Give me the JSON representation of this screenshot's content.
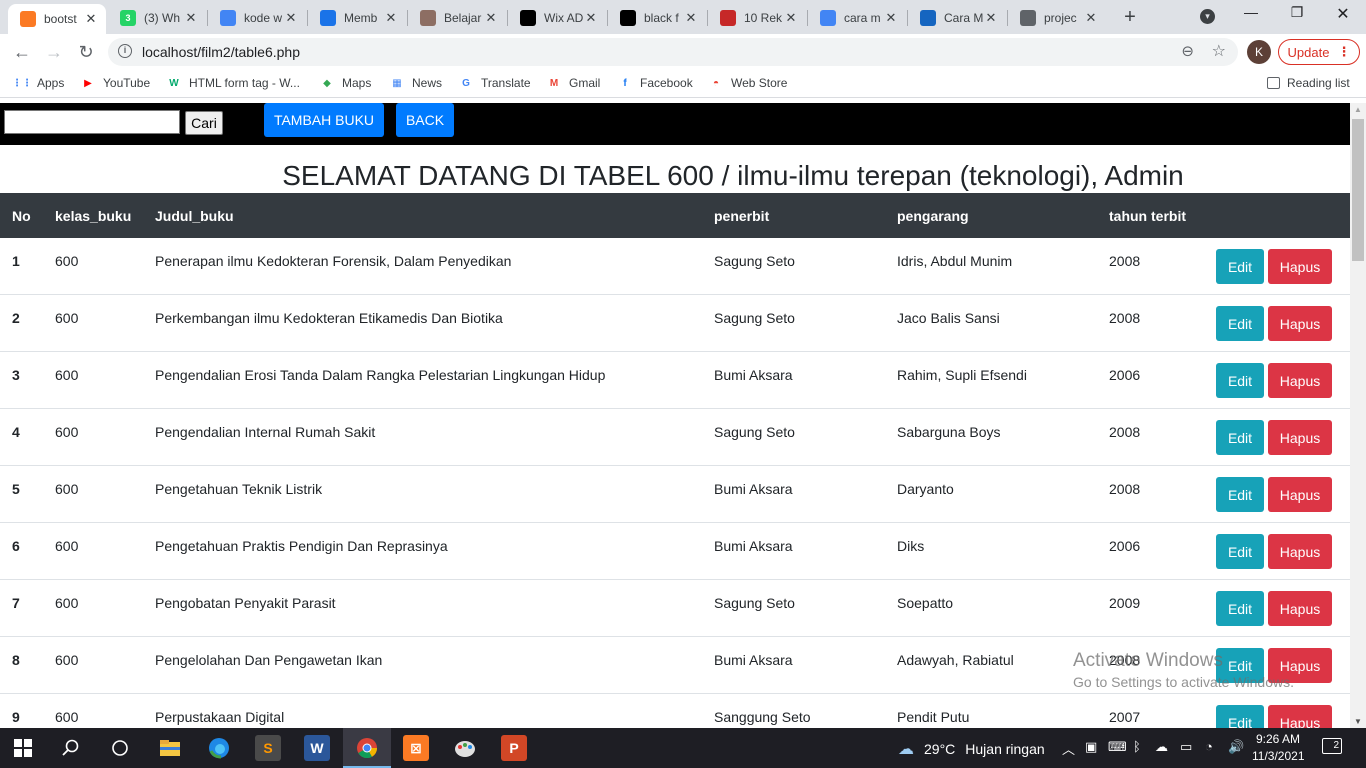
{
  "browser": {
    "tabs": [
      {
        "title": "bootst",
        "icon": "xampp-icon",
        "color": "#fb7a24",
        "active": true
      },
      {
        "title": "(3) Wh",
        "icon": "whatsapp-icon",
        "color": "#25d366",
        "badge": "3"
      },
      {
        "title": "kode w",
        "icon": "google-icon",
        "color": "#4285f4"
      },
      {
        "title": "Memb",
        "icon": "diamond-icon",
        "color": "#1a73e8"
      },
      {
        "title": "Belajar",
        "icon": "avatar-icon",
        "color": "#8d6e63"
      },
      {
        "title": "Wix AD",
        "icon": "wix-icon",
        "color": "#000000"
      },
      {
        "title": "black f",
        "icon": "unsplash-icon",
        "color": "#000000"
      },
      {
        "title": "10 Rek",
        "icon": "r-icon",
        "color": "#c62828"
      },
      {
        "title": "cara m",
        "icon": "google-icon",
        "color": "#4285f4"
      },
      {
        "title": "Cara M",
        "icon": "s-logo-icon",
        "color": "#1565c0"
      },
      {
        "title": "projec",
        "icon": "globe-icon",
        "color": "#5f6368"
      }
    ],
    "url": "localhost/film2/table6.php",
    "profile_initial": "K",
    "update_label": "Update",
    "bookmarks": [
      {
        "label": "Apps",
        "icon": "apps-grid-icon"
      },
      {
        "label": "YouTube",
        "icon": "youtube-icon"
      },
      {
        "label": "HTML form tag - W...",
        "icon": "w3schools-icon"
      },
      {
        "label": "Maps",
        "icon": "maps-icon"
      },
      {
        "label": "News",
        "icon": "news-icon"
      },
      {
        "label": "Translate",
        "icon": "translate-icon"
      },
      {
        "label": "Gmail",
        "icon": "gmail-icon"
      },
      {
        "label": "Facebook",
        "icon": "facebook-icon"
      },
      {
        "label": "Web Store",
        "icon": "webstore-icon"
      }
    ],
    "reading_list": "Reading list"
  },
  "page": {
    "search_button": "Cari",
    "search_value": "",
    "add_button": "TAMBAH BUKU",
    "back_button": "BACK",
    "title": "SELAMAT DATANG DI TABEL 600 / ilmu-ilmu terepan (teknologi), Admin",
    "columns": [
      "No",
      "kelas_buku",
      "Judul_buku",
      "penerbit",
      "pengarang",
      "tahun terbit"
    ],
    "edit_label": "Edit",
    "delete_label": "Hapus",
    "rows": [
      {
        "no": "1",
        "kelas": "600",
        "judul": "Penerapan ilmu Kedokteran Forensik, Dalam Penyedikan",
        "penerbit": "Sagung Seto",
        "pengarang": "Idris, Abdul Munim",
        "tahun": "2008"
      },
      {
        "no": "2",
        "kelas": "600",
        "judul": "Perkembangan ilmu Kedokteran Etikamedis Dan Biotika",
        "penerbit": "Sagung Seto",
        "pengarang": "Jaco Balis Sansi",
        "tahun": "2008"
      },
      {
        "no": "3",
        "kelas": "600",
        "judul": "Pengendalian Erosi Tanda Dalam Rangka Pelestarian Lingkungan Hidup",
        "penerbit": "Bumi Aksara",
        "pengarang": "Rahim, Supli Efsendi",
        "tahun": "2006"
      },
      {
        "no": "4",
        "kelas": "600",
        "judul": "Pengendalian Internal Rumah Sakit",
        "penerbit": "Sagung Seto",
        "pengarang": "Sabarguna Boys",
        "tahun": "2008"
      },
      {
        "no": "5",
        "kelas": "600",
        "judul": "Pengetahuan Teknik Listrik",
        "penerbit": "Bumi Aksara",
        "pengarang": "Daryanto",
        "tahun": "2008"
      },
      {
        "no": "6",
        "kelas": "600",
        "judul": "Pengetahuan Praktis Pendigin Dan Reprasinya",
        "penerbit": "Bumi Aksara",
        "pengarang": "Diks",
        "tahun": "2006"
      },
      {
        "no": "7",
        "kelas": "600",
        "judul": "Pengobatan Penyakit Parasit",
        "penerbit": "Sagung Seto",
        "pengarang": "Soepatto",
        "tahun": "2009"
      },
      {
        "no": "8",
        "kelas": "600",
        "judul": "Pengelolahan Dan Pengawetan Ikan",
        "penerbit": "Bumi Aksara",
        "pengarang": "Adawyah, Rabiatul",
        "tahun": "2008"
      },
      {
        "no": "9",
        "kelas": "600",
        "judul": "Perpustakaan Digital",
        "penerbit": "Sanggung Seto",
        "pengarang": "Pendit Putu",
        "tahun": "2007"
      }
    ]
  },
  "watermark": {
    "line1": "Activate Windows",
    "line2": "Go to Settings to activate Windows."
  },
  "taskbar": {
    "weather_temp": "29°C",
    "weather_text": "Hujan ringan",
    "time": "9:26 AM",
    "date": "11/3/2021",
    "notifications": "2"
  }
}
